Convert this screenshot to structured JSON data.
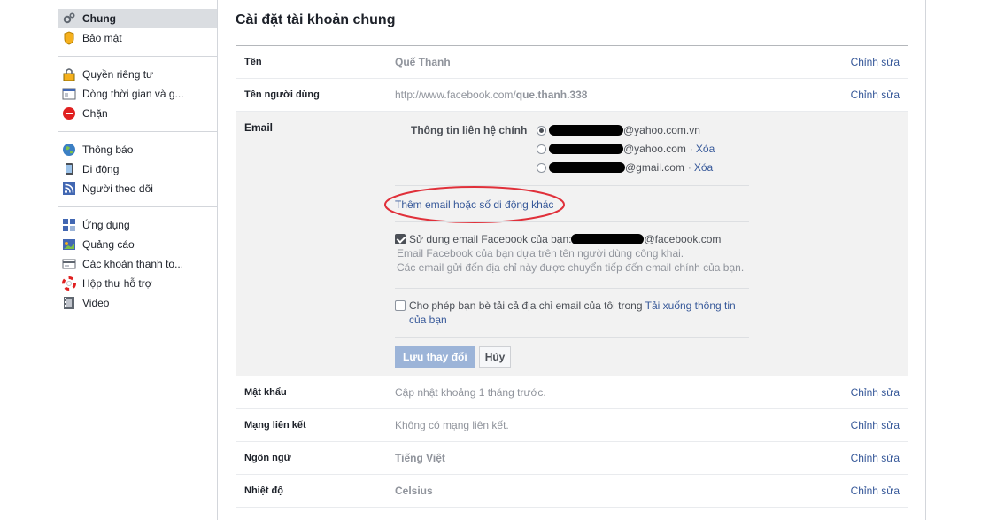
{
  "sidebar": {
    "items": [
      {
        "label": "Chung",
        "icon": "gear-icon",
        "active": true
      },
      {
        "label": "Bảo mật",
        "icon": "shield-icon"
      },
      {
        "label": "Quyền riêng tư",
        "icon": "lock-icon"
      },
      {
        "label": "Dòng thời gian và g...",
        "icon": "timeline-icon"
      },
      {
        "label": "Chặn",
        "icon": "block-icon"
      },
      {
        "label": "Thông báo",
        "icon": "globe-icon"
      },
      {
        "label": "Di động",
        "icon": "mobile-icon"
      },
      {
        "label": "Người theo dõi",
        "icon": "rss-icon"
      },
      {
        "label": "Ứng dụng",
        "icon": "apps-icon"
      },
      {
        "label": "Quảng cáo",
        "icon": "ads-icon"
      },
      {
        "label": "Các khoản thanh to...",
        "icon": "card-icon"
      },
      {
        "label": "Hộp thư hỗ trợ",
        "icon": "lifebuoy-icon"
      },
      {
        "label": "Video",
        "icon": "film-icon"
      }
    ]
  },
  "main": {
    "title": "Cài đặt tài khoản chung",
    "edit_label": "Chỉnh sửa",
    "rows": {
      "name": {
        "label": "Tên",
        "value": "Quế Thanh"
      },
      "username": {
        "label": "Tên người dùng",
        "value_prefix": "http://www.facebook.com/",
        "value_bold": "que.thanh.338"
      },
      "password": {
        "label": "Mật khẩu",
        "value": "Cập nhật khoảng 1 tháng trước."
      },
      "linked": {
        "label": "Mạng liên kết",
        "value": "Không có mạng liên kết."
      },
      "language": {
        "label": "Ngôn ngữ",
        "value": "Tiếng Việt"
      },
      "temperature": {
        "label": "Nhiệt độ",
        "value": "Celsius"
      }
    },
    "email": {
      "label": "Email",
      "primary_contact_label": "Thông tin liên hệ chính",
      "options": [
        {
          "suffix": "@yahoo.com.vn",
          "selected": true
        },
        {
          "suffix": "@yahoo.com",
          "remove": "Xóa",
          "selected": false
        },
        {
          "suffix": "@gmail.com",
          "remove": "Xóa",
          "selected": false
        }
      ],
      "add_link": "Thêm email hoặc số di động khác",
      "fb_email_label": "Sử dụng email Facebook của bạn:",
      "fb_email_suffix": "@facebook.com",
      "fb_email_checked": true,
      "fb_email_desc1": "Email Facebook của bạn dựa trên tên người dùng công khai.",
      "fb_email_desc2": "Các email gửi đến địa chỉ này được chuyển tiếp đến email chính của bạn.",
      "download_text": "Cho phép bạn bè tải cả địa chỉ email của tôi trong",
      "download_link": "Tải xuống thông tin của bạn",
      "download_checked": false,
      "save_label": "Lưu thay đổi",
      "cancel_label": "Hủy"
    },
    "colors": {
      "link": "#365899",
      "annotation_oval": "#e0303a"
    }
  }
}
